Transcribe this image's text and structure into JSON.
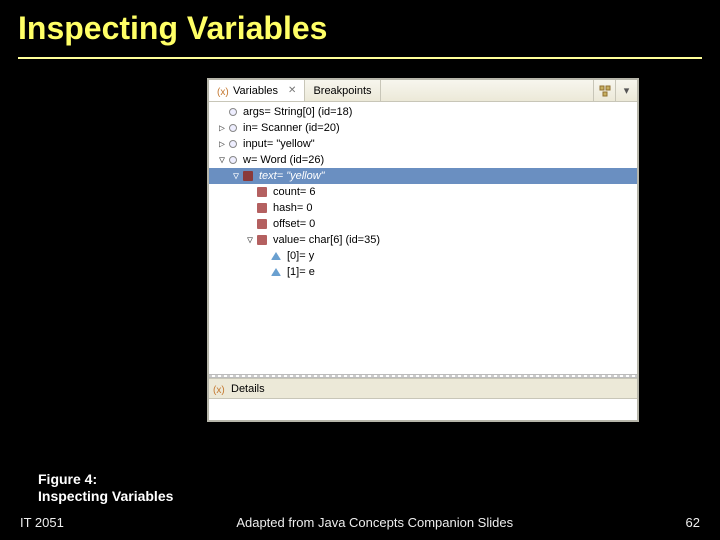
{
  "slide": {
    "title": "Inspecting Variables"
  },
  "tabs": {
    "variables": "Variables",
    "breakpoints": "Breakpoints"
  },
  "tree": {
    "row0": {
      "text": "args= String[0]  (id=18)"
    },
    "row1": {
      "text": "in= Scanner (id=20)"
    },
    "row2": {
      "text": "input=  \"yellow\""
    },
    "row3": {
      "text": "w= Word (id=26)"
    },
    "row4": {
      "text": "text=  \"yellow\""
    },
    "row5": {
      "text": "count= 6"
    },
    "row6": {
      "text": "hash= 0"
    },
    "row7": {
      "text": "offset= 0"
    },
    "row8": {
      "text": "value= char[6] (id=35)"
    },
    "row9": {
      "text": "[0]= y"
    },
    "row10": {
      "text": "[1]= e"
    }
  },
  "details": {
    "title": "Details"
  },
  "caption": {
    "line1": "Figure 4:",
    "line2": "Inspecting Variables"
  },
  "footer": {
    "left": "IT 2051",
    "center": "Adapted from Java Concepts Companion Slides",
    "right": "62"
  }
}
